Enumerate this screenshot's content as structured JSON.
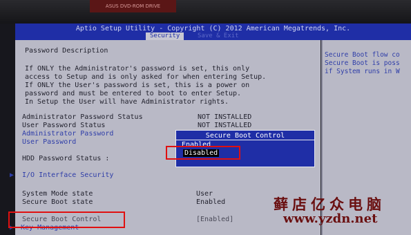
{
  "bezel": {
    "brand_text": "ASUS DVD-ROM DRIVE"
  },
  "header": {
    "title": "Aptio Setup Utility - Copyright (C) 2012 American Megatrends, Inc.",
    "active_tab": "Security",
    "next_tab": "Save & Exit"
  },
  "main": {
    "section_title": "Password Description",
    "description": [
      "If ONLY the Administrator's password is set, this only",
      "access to Setup and is only asked for when entering Setup.",
      "If ONLY the User's password is set, this is a power on",
      "password and must be entered to boot to enter Setup.",
      "In Setup the User will have Administrator rights."
    ],
    "admin_status_label": "Administrator Password Status",
    "admin_status_value": "NOT INSTALLED",
    "user_status_label": "User Password Status",
    "user_status_value": "NOT INSTALLED",
    "admin_password_link": "Administrator Password",
    "user_password_link": "User Password",
    "hdd_password_label": "HDD Password Status  :",
    "io_security_link": "I/O Interface Security",
    "system_mode_label": "System Mode state",
    "system_mode_value": "User",
    "secure_boot_label": "Secure Boot state",
    "secure_boot_value": "Enabled",
    "secure_boot_control_label": "Secure Boot Control",
    "secure_boot_control_value": "[Enabled]",
    "key_management_label": "Key Management"
  },
  "popup": {
    "title": "Secure Boot Control",
    "options": [
      "Enabled",
      "Disabled"
    ],
    "selected": "Disabled"
  },
  "help": {
    "lines": [
      "Secure Boot flow co",
      "Secure Boot is poss",
      "if System runs in W"
    ]
  },
  "watermark": {
    "chinese": "藓店亿众电脑",
    "url": "www.yzdn.net"
  },
  "colors": {
    "bios_blue": "#1f2ea6",
    "panel_gray": "#b9b9c6",
    "highlight_red": "#e01010"
  }
}
